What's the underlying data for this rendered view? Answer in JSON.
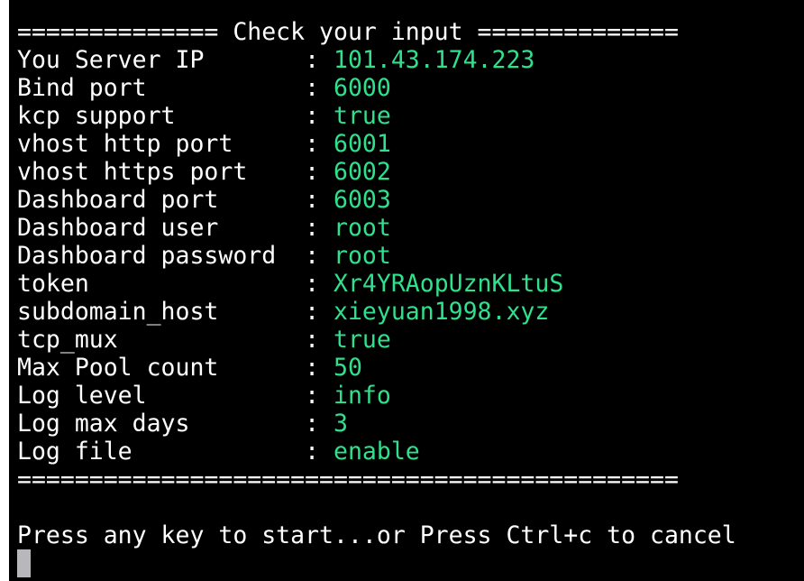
{
  "terminal": {
    "header": "============== Check your input ==============",
    "rows": [
      {
        "key": "You Server IP",
        "value": "101.43.174.223"
      },
      {
        "key": "Bind port",
        "value": "6000"
      },
      {
        "key": "kcp support",
        "value": "true"
      },
      {
        "key": "vhost http port",
        "value": "6001"
      },
      {
        "key": "vhost https port",
        "value": "6002"
      },
      {
        "key": "Dashboard port",
        "value": "6003"
      },
      {
        "key": "Dashboard user",
        "value": "root"
      },
      {
        "key": "Dashboard password",
        "value": "root"
      },
      {
        "key": "token",
        "value": "Xr4YRAopUznKLtuS"
      },
      {
        "key": "subdomain_host",
        "value": "xieyuan1998.xyz"
      },
      {
        "key": "tcp_mux",
        "value": "true"
      },
      {
        "key": "Max Pool count",
        "value": "50"
      },
      {
        "key": "Log level",
        "value": "info"
      },
      {
        "key": "Log max days",
        "value": "3"
      },
      {
        "key": "Log file",
        "value": "enable"
      }
    ],
    "separator_char": ":",
    "footer": "==============================================",
    "prompt": "Press any key to start...or Press Ctrl+c to cancel"
  },
  "colors": {
    "background": "#000000",
    "text": "#ffffff",
    "value": "#2fe08c",
    "cursor": "#b8b8bc"
  }
}
